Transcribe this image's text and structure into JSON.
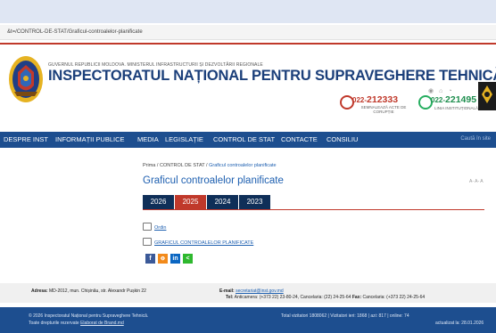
{
  "browser": {
    "url": "&t=/CONTROL-DE-STAT/Graficul-controalelor-planificate"
  },
  "header": {
    "gov_line": "GUVERNUL REPUBLICII MOLDOVA. MINISTERUL INFRASTRUCTURII ȘI DEZVOLTĂRII REGIONALE",
    "title": "INSPECTORATUL NAȚIONAL PENTRU SUPRAVEGHERE TEHNICĂ",
    "hotline_corruption": {
      "prefix": "022-",
      "number": "212333",
      "label": "SEMNALEAZĂ ACTE DE CORUPȚIE"
    },
    "hotline_institutional": {
      "prefix": "022-",
      "number": "221495",
      "label": "LINIA INSTITUȚIONALĂ"
    }
  },
  "nav": {
    "items": [
      "DESPRE INST",
      "INFORMAȚII PUBLICE",
      "MEDIA",
      "LEGISLAȚIE",
      "CONTROL DE STAT",
      "CONTACTE",
      "CONSILIU"
    ],
    "search_placeholder": "Caută în site"
  },
  "breadcrumb": {
    "home": "Prima",
    "sep": "/",
    "section": "CONTROL DE STAT",
    "current": "Graficul controalelor planificate"
  },
  "page": {
    "title": "Graficul controalelor planificate",
    "font_sizer": "A- A- A"
  },
  "tabs": [
    {
      "label": "2026",
      "active": false
    },
    {
      "label": "2025",
      "active": true
    },
    {
      "label": "2024",
      "active": false
    },
    {
      "label": "2023",
      "active": false
    }
  ],
  "documents": [
    "Ordin",
    "GRAFICUL CONTROALELOR PLANIFICATE"
  ],
  "share": [
    {
      "icon": "facebook-icon",
      "glyph": "f",
      "color": "#3b5998"
    },
    {
      "icon": "odnoklassniki-icon",
      "glyph": "ok",
      "color": "#f28a1b"
    },
    {
      "icon": "linkedin-icon",
      "glyph": "in",
      "color": "#0a66c2"
    },
    {
      "icon": "share-icon",
      "glyph": "<",
      "color": "#2eb82e"
    }
  ],
  "footer": {
    "address_label": "Adresa:",
    "address": "MD-2012, mun. Chișinău, str. Alexandr Pușkin 22",
    "email_label": "E-mail:",
    "email": "secretariat@inst.gov.md",
    "tel_label": "Tel:",
    "tel": "Anticamera: (+373 22) 23-80-24, Cancelaria: (22) 24-25-64",
    "fax_label": "Fax:",
    "fax": "Cancelaria: (+373 22) 24-25-64",
    "copyright": "© 2026 Inspectoratul Național pentru Supraveghere Tehnică.",
    "rights": "Toate drepturile rezervate",
    "made_by": "Elaborat de Brand.md",
    "stats": "Total vizitatori 1808062 | Vizitatori ieri: 1868 | azi: 817 | online: 74",
    "updated": "actualizat la: 28.01.2026"
  },
  "colors": {
    "nav_blue": "#1d4e8f",
    "accent_red": "#c0392b",
    "tab_dark": "#0f2f58",
    "link_blue": "#1d5fb0"
  }
}
